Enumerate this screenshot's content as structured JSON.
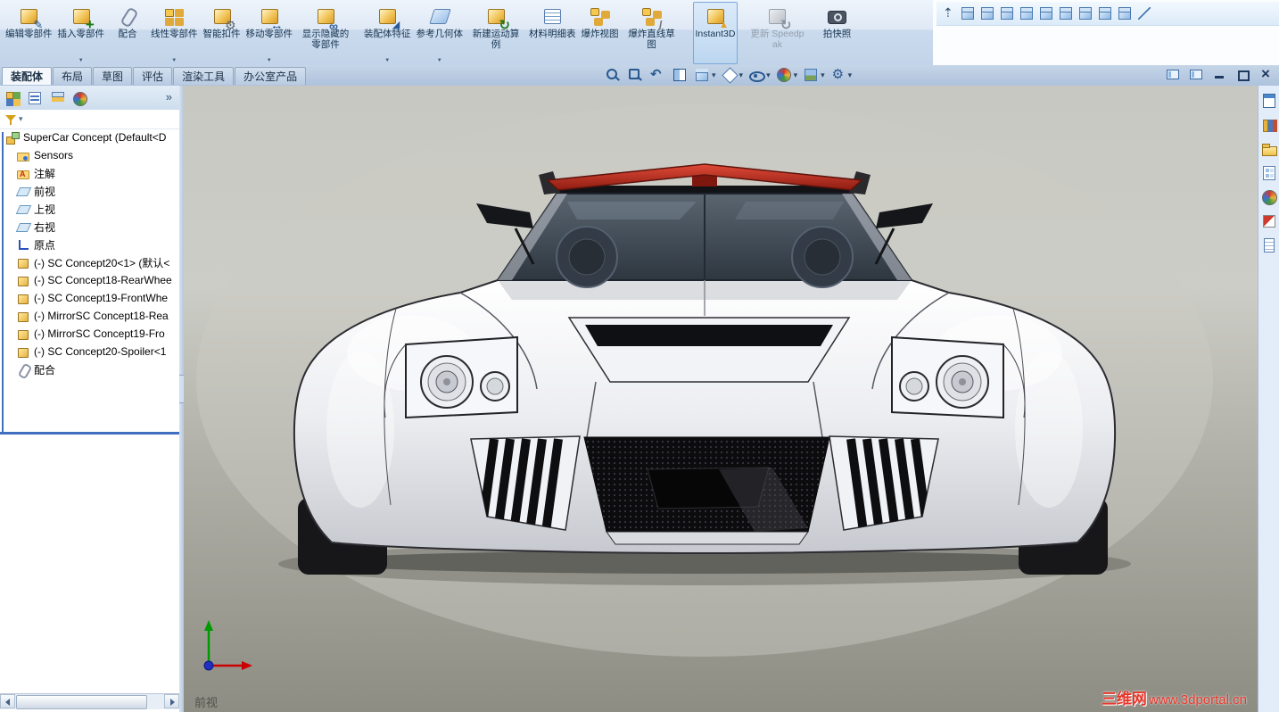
{
  "colors": {
    "accent_blue": "#2a6fc0",
    "spoiler_red": "#c03427",
    "ribbon_bg": "#d8e5f3",
    "viewport_top": "#c8c8c2",
    "viewport_bottom": "#8d8d83"
  },
  "ribbon": {
    "buttons": [
      {
        "label": "编辑零部件",
        "icon": "edit-component"
      },
      {
        "label": "插入零部件",
        "icon": "insert-component",
        "dropdown": true
      },
      {
        "label": "配合",
        "icon": "mate"
      },
      {
        "label": "线性零部件",
        "icon": "linear-pattern",
        "dropdown": true
      },
      {
        "label": "智能扣件",
        "icon": "smart-fastener"
      },
      {
        "label": "移动零部件",
        "icon": "move-component",
        "dropdown": true
      },
      {
        "label": "显示隐藏的零部件",
        "icon": "show-hidden"
      },
      {
        "label": "装配体特征",
        "icon": "assembly-feature",
        "dropdown": true
      },
      {
        "label": "参考几何体",
        "icon": "reference-geometry",
        "dropdown": true
      },
      {
        "label": "新建运动算例",
        "icon": "motion-study"
      },
      {
        "label": "材料明细表",
        "icon": "bom"
      },
      {
        "label": "爆炸视图",
        "icon": "exploded-view"
      },
      {
        "label": "爆炸直线草图",
        "icon": "explode-line-sketch"
      },
      {
        "label": "Instant3D",
        "icon": "instant3d",
        "state": "active"
      },
      {
        "label": "更新 Speedpak",
        "icon": "speedpak",
        "state": "disabled"
      },
      {
        "label": "拍快照",
        "icon": "snapshot"
      }
    ]
  },
  "quick_view_toolbar": {
    "icons": [
      {
        "icon": "toolbar-collapse-arrow"
      },
      {
        "icon": "view-cube-a"
      },
      {
        "icon": "view-cube-b"
      },
      {
        "icon": "view-cube-c"
      },
      {
        "icon": "view-cube-d"
      },
      {
        "icon": "view-cube-e"
      },
      {
        "icon": "view-cube-f"
      },
      {
        "icon": "view-cube-g"
      },
      {
        "icon": "view-cube-h"
      },
      {
        "icon": "view-cube-i"
      },
      {
        "icon": "line-tool"
      }
    ]
  },
  "command_tabs": [
    {
      "label": "装配体",
      "active": true
    },
    {
      "label": "布局"
    },
    {
      "label": "草图"
    },
    {
      "label": "评估"
    },
    {
      "label": "渲染工具"
    },
    {
      "label": "办公室产品"
    }
  ],
  "heads_up": {
    "icons": [
      {
        "name": "zoom-fit"
      },
      {
        "name": "zoom-area"
      },
      {
        "name": "previous-view"
      },
      {
        "name": "section-view"
      },
      {
        "name": "view-orientation",
        "dropdown": true
      },
      {
        "name": "display-style",
        "dropdown": true
      },
      {
        "name": "hide-show-items",
        "dropdown": true
      },
      {
        "name": "edit-appearance",
        "dropdown": true
      },
      {
        "name": "apply-scene",
        "dropdown": true
      },
      {
        "name": "view-settings",
        "dropdown": true
      }
    ]
  },
  "feature_panel": {
    "tabs": [
      {
        "icon": "feature-manager"
      },
      {
        "icon": "property-manager"
      },
      {
        "icon": "configuration-manager"
      },
      {
        "icon": "display-manager"
      }
    ],
    "overflow_chevron": "»",
    "items": [
      {
        "icon": "assembly",
        "label": "SuperCar Concept (Default<D",
        "indent": 0
      },
      {
        "icon": "sensors",
        "label": "Sensors",
        "indent": 1
      },
      {
        "icon": "annotations",
        "label": "注解",
        "indent": 1
      },
      {
        "icon": "plane",
        "label": "前视",
        "indent": 1
      },
      {
        "icon": "plane",
        "label": "上视",
        "indent": 1
      },
      {
        "icon": "plane",
        "label": "右视",
        "indent": 1
      },
      {
        "icon": "origin",
        "label": "原点",
        "indent": 1
      },
      {
        "icon": "part",
        "label": "(-) SC Concept20<1> (默认<",
        "indent": 1
      },
      {
        "icon": "part",
        "label": "(-) SC Concept18-RearWhee",
        "indent": 1
      },
      {
        "icon": "part",
        "label": "(-) SC Concept19-FrontWhe",
        "indent": 1
      },
      {
        "icon": "part",
        "label": "(-) MirrorSC Concept18-Rea",
        "indent": 1
      },
      {
        "icon": "part",
        "label": "(-) MirrorSC Concept19-Fro",
        "indent": 1
      },
      {
        "icon": "part",
        "label": "(-) SC Concept20-Spoiler<1",
        "indent": 1
      },
      {
        "icon": "mates",
        "label": "配合",
        "indent": 1
      }
    ]
  },
  "task_pane": {
    "icons": [
      {
        "icon": "resources"
      },
      {
        "icon": "design-library"
      },
      {
        "icon": "file-explorer"
      },
      {
        "icon": "view-palette"
      },
      {
        "icon": "appearances"
      },
      {
        "icon": "decals"
      },
      {
        "icon": "custom-properties"
      }
    ]
  },
  "viewport": {
    "view_label": "前视",
    "watermark_brand": "三维网",
    "watermark_url": "www.3dportal.cn"
  }
}
